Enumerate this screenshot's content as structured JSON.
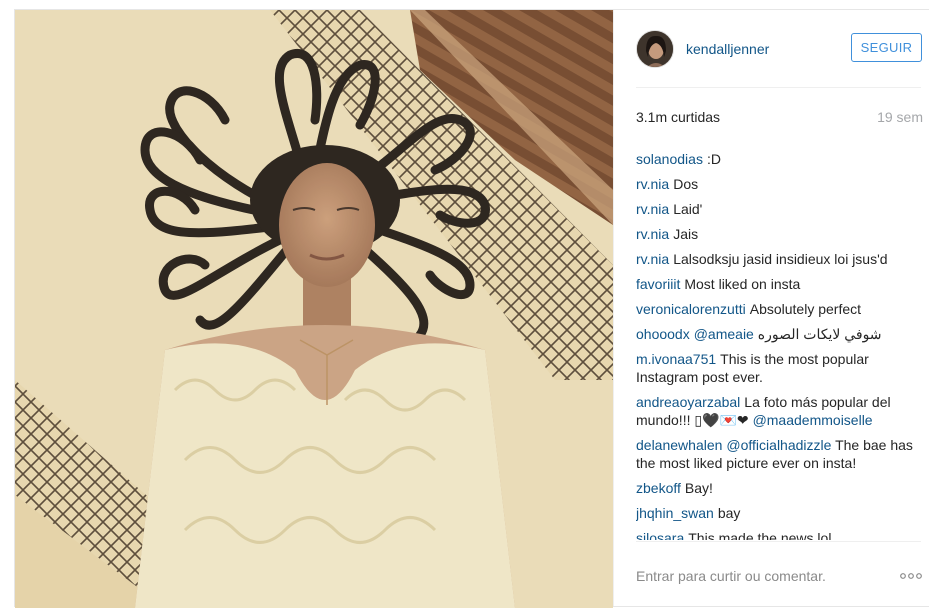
{
  "post": {
    "username": "kendalljenner",
    "follow_label": "SEGUIR",
    "likes": "3.1m curtidas",
    "time": "19 sem",
    "comments": [
      {
        "user": "solanodias",
        "text": ":D"
      },
      {
        "user": "rv.nia",
        "text": "Dos"
      },
      {
        "user": "rv.nia",
        "text": "Laid'"
      },
      {
        "user": "rv.nia",
        "text": "Jais"
      },
      {
        "user": "rv.nia",
        "text": "Lalsodksju jasid insidieux loi jsus'd"
      },
      {
        "user": "favoriiit",
        "text": "Most liked on insta"
      },
      {
        "user": "veronicalorenzutti",
        "text": "Absolutely perfect"
      },
      {
        "user": "ohooodx",
        "mention": "@ameaie",
        "text": "شوفي لايكات الصوره"
      },
      {
        "user": "m.ivonaa751",
        "text": "This is the most popular Instagram post ever."
      },
      {
        "user": "andreaoyarzabal",
        "text": "La foto más popular del mundo!!! ▯🖤💌❤",
        "mention_after": "@maademmoiselle"
      },
      {
        "user": "delanewhalen",
        "mention": "@officialhadizzle",
        "text": "The bae has the most liked picture ever on insta!"
      },
      {
        "user": "zbekoff",
        "text": "Bay!"
      },
      {
        "user": "jhqhin_swan",
        "text": "bay"
      },
      {
        "user": "silosara",
        "text": "This made the news lol"
      }
    ],
    "comment_placeholder": "Entrar para curtir ou comentar.",
    "more_icon": "ellipsis-icon"
  },
  "colors": {
    "link": "#125688",
    "follow_border": "#4090db",
    "muted": "#a5a7aa"
  }
}
